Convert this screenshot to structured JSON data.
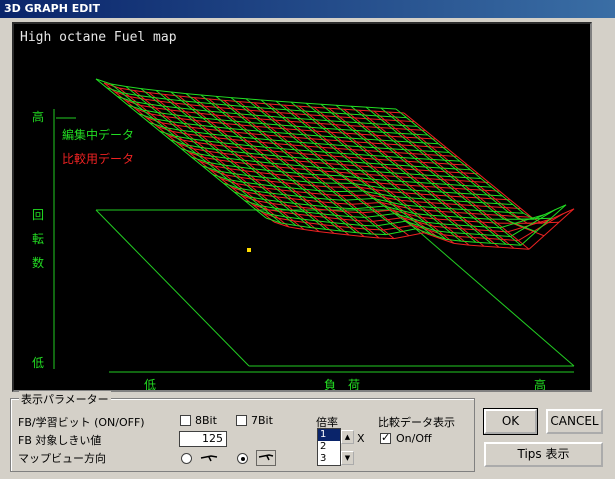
{
  "window": {
    "title": "3D GRAPH EDIT"
  },
  "graph": {
    "map_title": "High octane Fuel map",
    "y_axis": {
      "high": "高",
      "label_chars": [
        "回",
        "転",
        "数"
      ],
      "low": "低"
    },
    "x_axis": {
      "low": "低",
      "label": "負　荷",
      "high": "高"
    },
    "legend": {
      "edit": "編集中データ",
      "compare": "比較用データ"
    },
    "colors": {
      "edit": "#22dd22",
      "compare": "#ee2222",
      "axis": "#22cc22",
      "background": "#000000",
      "cursor": "#ffdd00"
    }
  },
  "params": {
    "group_label": "表示パラメーター",
    "fb_bit_label": "FB/学習ビット (ON/OFF)",
    "bit8": {
      "label": "8Bit",
      "checked": false
    },
    "bit7": {
      "label": "7Bit",
      "checked": false
    },
    "threshold_label": "FB 対象しきい値",
    "threshold_value": "125",
    "view_dir_label": "マップビュー方向",
    "view_options": [
      {
        "icon": "view-direction-1-icon",
        "selected": false
      },
      {
        "icon": "view-direction-2-icon",
        "selected": true
      }
    ],
    "scale_label": "倍率",
    "scale_options": [
      "1",
      "2",
      "3"
    ],
    "scale_selected": "1",
    "scale_suffix": "X",
    "compare_label": "比較データ表示",
    "compare_toggle": {
      "label": "On/Off",
      "checked": true
    }
  },
  "buttons": {
    "ok": "OK",
    "cancel": "CANCEL",
    "tips": "Tips 表示"
  }
}
